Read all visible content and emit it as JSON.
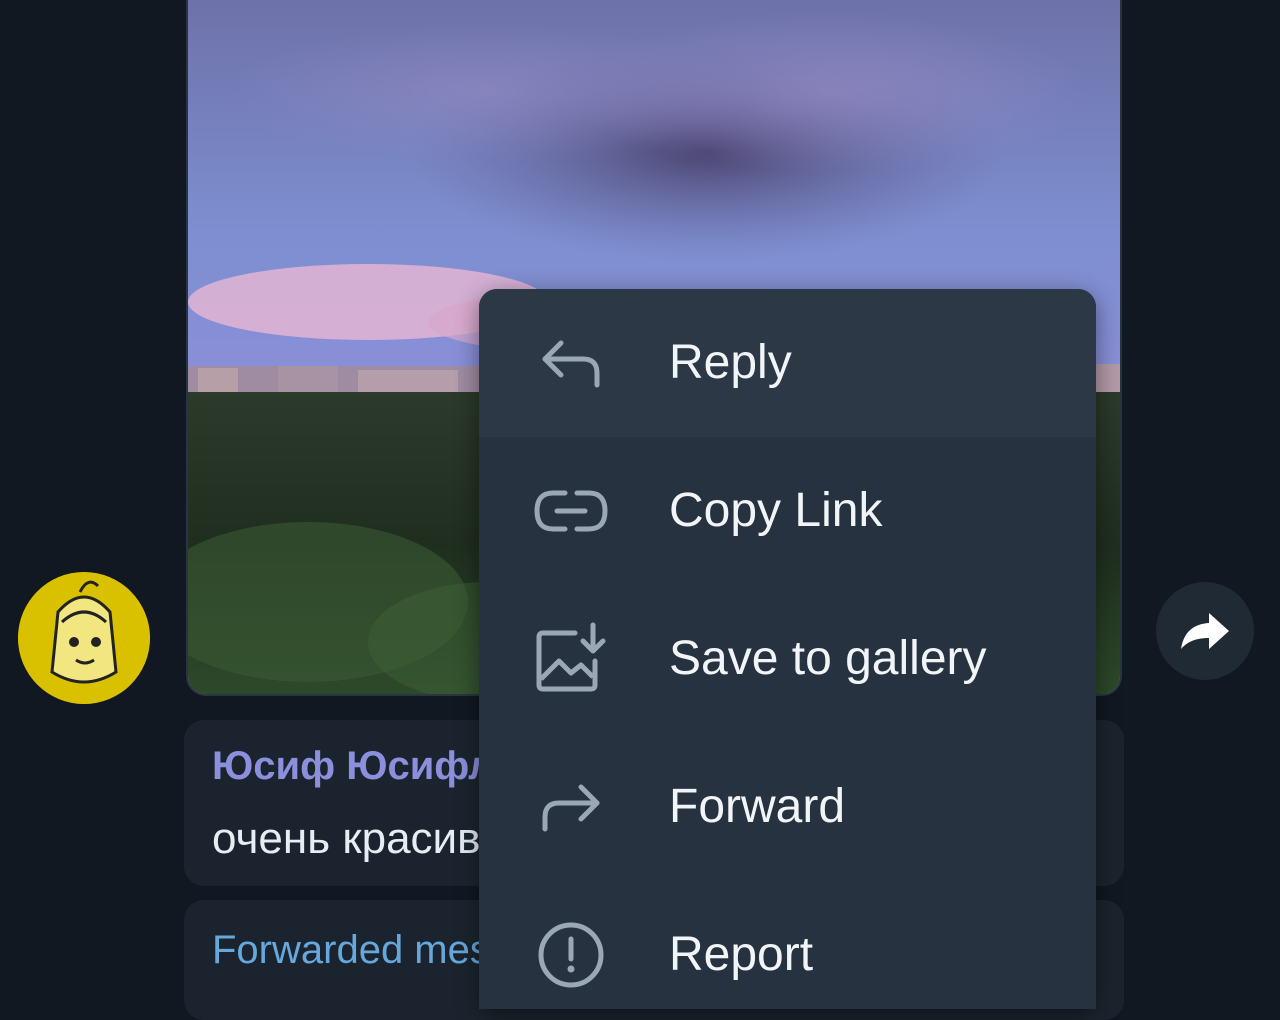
{
  "context_menu": {
    "items": [
      {
        "label": "Reply",
        "icon": "reply-arrow-icon"
      },
      {
        "label": "Copy Link",
        "icon": "link-icon"
      },
      {
        "label": "Save to gallery",
        "icon": "save-to-gallery-icon"
      },
      {
        "label": "Forward",
        "icon": "forward-arrow-icon"
      },
      {
        "label": "Report",
        "icon": "report-exclamation-icon"
      }
    ]
  },
  "messages": [
    {
      "sender": "Юсиф Юсифли",
      "text": "очень красиво"
    },
    {
      "forwarded_label": "Forwarded message"
    }
  ],
  "share_button": {
    "icon": "share-arrow-icon"
  },
  "avatar": {
    "icon": "anime-avatar"
  },
  "colors": {
    "background": "#111821",
    "menu_bg": "#26323f",
    "menu_highlight": "#2c3846",
    "sender_name": "#8b8fdc",
    "forwarded_label": "#66a8dc",
    "message_text": "#e6edf3",
    "icon_gray": "#9aa8b6"
  }
}
